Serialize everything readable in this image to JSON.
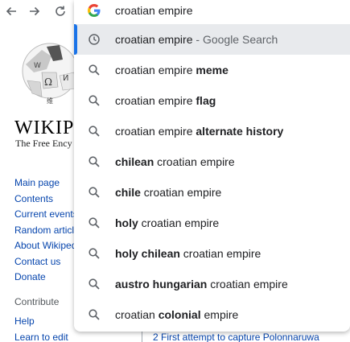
{
  "omnibox": {
    "query": "croatian empire",
    "suggestions": [
      {
        "pre": "",
        "bold": "",
        "post": "croatian empire",
        "suffix": " - Google Search",
        "icon": "history-icon",
        "selected": true
      },
      {
        "pre": "croatian empire ",
        "bold": "meme",
        "post": "",
        "suffix": "",
        "icon": "search-icon"
      },
      {
        "pre": "croatian empire ",
        "bold": "flag",
        "post": "",
        "suffix": "",
        "icon": "search-icon"
      },
      {
        "pre": "croatian empire ",
        "bold": "alternate history",
        "post": "",
        "suffix": "",
        "icon": "search-icon"
      },
      {
        "pre": "",
        "bold": "chilean",
        "post": " croatian empire",
        "suffix": "",
        "icon": "search-icon"
      },
      {
        "pre": "",
        "bold": "chile",
        "post": " croatian empire",
        "suffix": "",
        "icon": "search-icon"
      },
      {
        "pre": "",
        "bold": "holy",
        "post": " croatian empire",
        "suffix": "",
        "icon": "search-icon"
      },
      {
        "pre": "",
        "bold": "holy chilean",
        "post": " croatian empire",
        "suffix": "",
        "icon": "search-icon"
      },
      {
        "pre": "",
        "bold": "austro hungarian",
        "post": " croatian empire",
        "suffix": "",
        "icon": "search-icon"
      },
      {
        "pre": "croatian ",
        "bold": "colonial",
        "post": " empire",
        "suffix": "",
        "icon": "search-icon"
      }
    ]
  },
  "wiki": {
    "wordmark": "WIKIPE",
    "tagline": "The Free Ency",
    "nav": [
      "Main page",
      "Contents",
      "Current events",
      "Random article",
      "About Wikipedia",
      "Contact us",
      "Donate"
    ],
    "contribute_heading": "Contribute",
    "contribute": [
      "Help",
      "Learn to edit"
    ],
    "toc_item": "2 First attempt to capture Polonnaruwa"
  },
  "colors": {
    "accent": "#1a73e8",
    "link": "#0645ad",
    "selected_bg": "#e8eaed"
  }
}
